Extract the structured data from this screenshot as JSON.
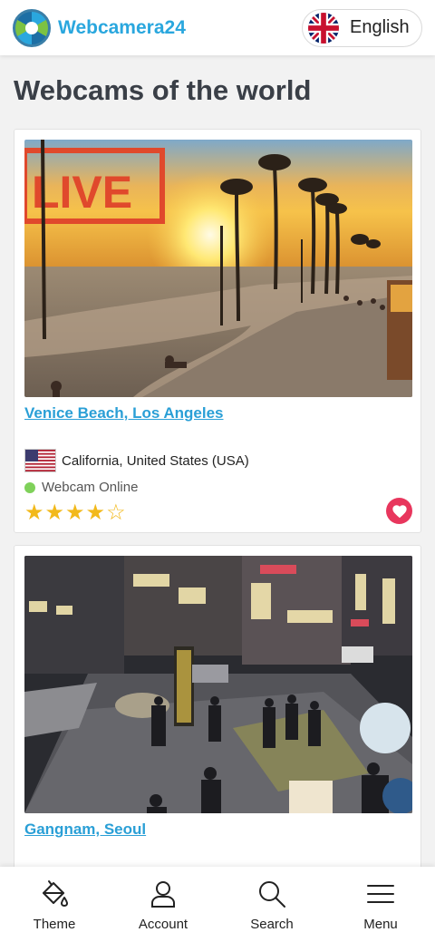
{
  "header": {
    "brand": "Webcamera24",
    "language": "English",
    "logo_icon": "camera-aperture-icon",
    "lang_icon": "uk-flag-icon"
  },
  "page_title": "Webcams of the world",
  "cards": [
    {
      "title": "Venice Beach, Los Angeles",
      "location": "California, United States (USA)",
      "status": "Webcam Online",
      "overlay": "LIVE",
      "rating": 4,
      "rating_max": 5,
      "favorite_icon": "heart-icon"
    },
    {
      "title": "Gangnam, Seoul"
    }
  ],
  "bottom_nav": [
    {
      "label": "Theme",
      "icon": "paint-bucket-icon"
    },
    {
      "label": "Account",
      "icon": "user-icon"
    },
    {
      "label": "Search",
      "icon": "search-icon"
    },
    {
      "label": "Menu",
      "icon": "hamburger-menu-icon"
    }
  ],
  "colors": {
    "brand": "#2aa7de",
    "link": "#2a9fd6",
    "online": "#7fd15a",
    "favorite": "#e8365d",
    "star": "#f2b91b"
  }
}
